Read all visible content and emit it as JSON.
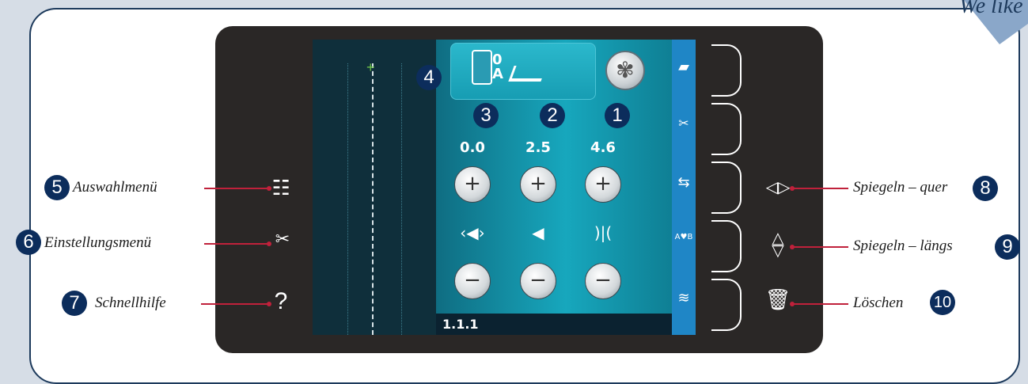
{
  "corner_text": "We like",
  "colors": {
    "frame": "#1d3a5c",
    "badge": "#0c2d5c",
    "leader": "#c0213b",
    "panel": "#17a7bd",
    "tool_column": "#1f86c6"
  },
  "screen": {
    "top_box": {
      "badge": "4",
      "foot_code_top": "0",
      "foot_code_bottom": "A",
      "icons": [
        "presser-foot-icon",
        "sensor-foot-icon"
      ]
    },
    "fan_button_icon": "fan-icon",
    "controls": [
      {
        "badge": "3",
        "value": "0.0",
        "plus": "+",
        "minus": "−",
        "icon": "balance-icon",
        "icon_glyph": "‹◀›"
      },
      {
        "badge": "2",
        "value": "2.5",
        "plus": "+",
        "minus": "−",
        "icon": "stitch-width-icon",
        "icon_glyph": "◀"
      },
      {
        "badge": "1",
        "value": "4.6",
        "plus": "+",
        "minus": "−",
        "icon": "stitch-length-icon",
        "icon_glyph": ")|("
      }
    ],
    "stitch_number": "1.1.1",
    "tool_icons": [
      "load-folder-icon",
      "tie-cut-icon",
      "stitch-mirror-icon",
      "sequence-icon",
      "zigzag-icon"
    ],
    "tool_glyphs": [
      "📂",
      "✂",
      "⇆",
      "A♥B",
      "≋"
    ]
  },
  "callouts_left": [
    {
      "badge": "5",
      "label": "Auswahlmenü",
      "icon": "menu-grid-icon",
      "glyph": "☷"
    },
    {
      "badge": "6",
      "label": "Einstellungsmenü",
      "icon": "tools-icon",
      "glyph": "✂"
    },
    {
      "badge": "7",
      "label": "Schnellhilfe",
      "icon": "help-icon",
      "glyph": "?"
    }
  ],
  "callouts_right": [
    {
      "badge": "8",
      "label": "Spiegeln – quer",
      "icon": "mirror-side-icon",
      "glyph": "◁|▷"
    },
    {
      "badge": "9",
      "label": "Spiegeln – längs",
      "icon": "mirror-end-icon",
      "glyph": "△▽"
    },
    {
      "badge": "10",
      "label": "Löschen",
      "icon": "trash-icon",
      "glyph": "🗑"
    }
  ]
}
